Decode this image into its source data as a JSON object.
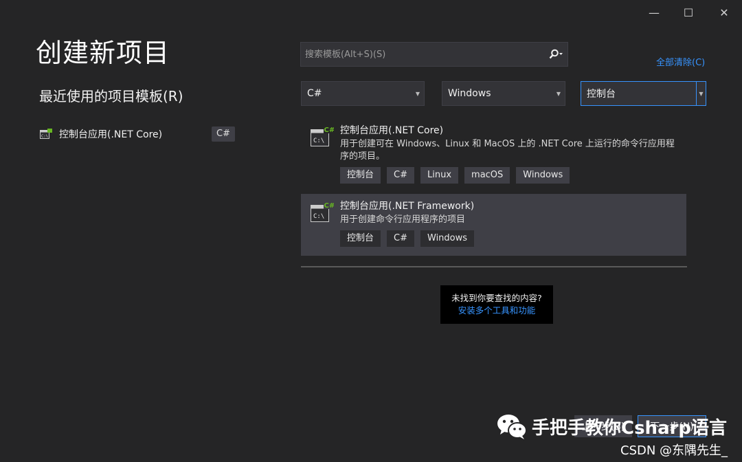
{
  "window": {
    "minimize": "—",
    "maximize": "☐",
    "close": "✕"
  },
  "title": "创建新项目",
  "recent": {
    "heading": "最近使用的项目模板(R)",
    "items": [
      {
        "name": "控制台应用(.NET Core)",
        "lang": "C#"
      }
    ]
  },
  "search": {
    "placeholder": "搜索模板(Alt+S)(S)",
    "icon": "search-icon"
  },
  "clear_all": "全部清除(C)",
  "filters": {
    "language": "C#",
    "platform": "Windows",
    "project_type": "控制台"
  },
  "templates": [
    {
      "name": "控制台应用(.NET Core)",
      "description": "用于创建可在 Windows、Linux 和 MacOS 上的 .NET Core 上运行的命令行应用程序的项目。",
      "tags": [
        "控制台",
        "C#",
        "Linux",
        "macOS",
        "Windows"
      ]
    },
    {
      "name": "控制台应用(.NET Framework)",
      "description": "用于创建命令行应用程序的项目",
      "tags": [
        "控制台",
        "C#",
        "Windows"
      ]
    }
  ],
  "not_found": {
    "question": "未找到你要查找的内容?",
    "link": "安装多个工具和功能"
  },
  "footer": {
    "back": "上一步(B)",
    "next": "下一步(N)"
  },
  "watermark": {
    "text": "手把手教你Csharp语言",
    "credit": "CSDN @东隅先生_"
  },
  "colors": {
    "accent": "#3794ff",
    "background": "#252526",
    "csharp_green": "#68b723"
  }
}
